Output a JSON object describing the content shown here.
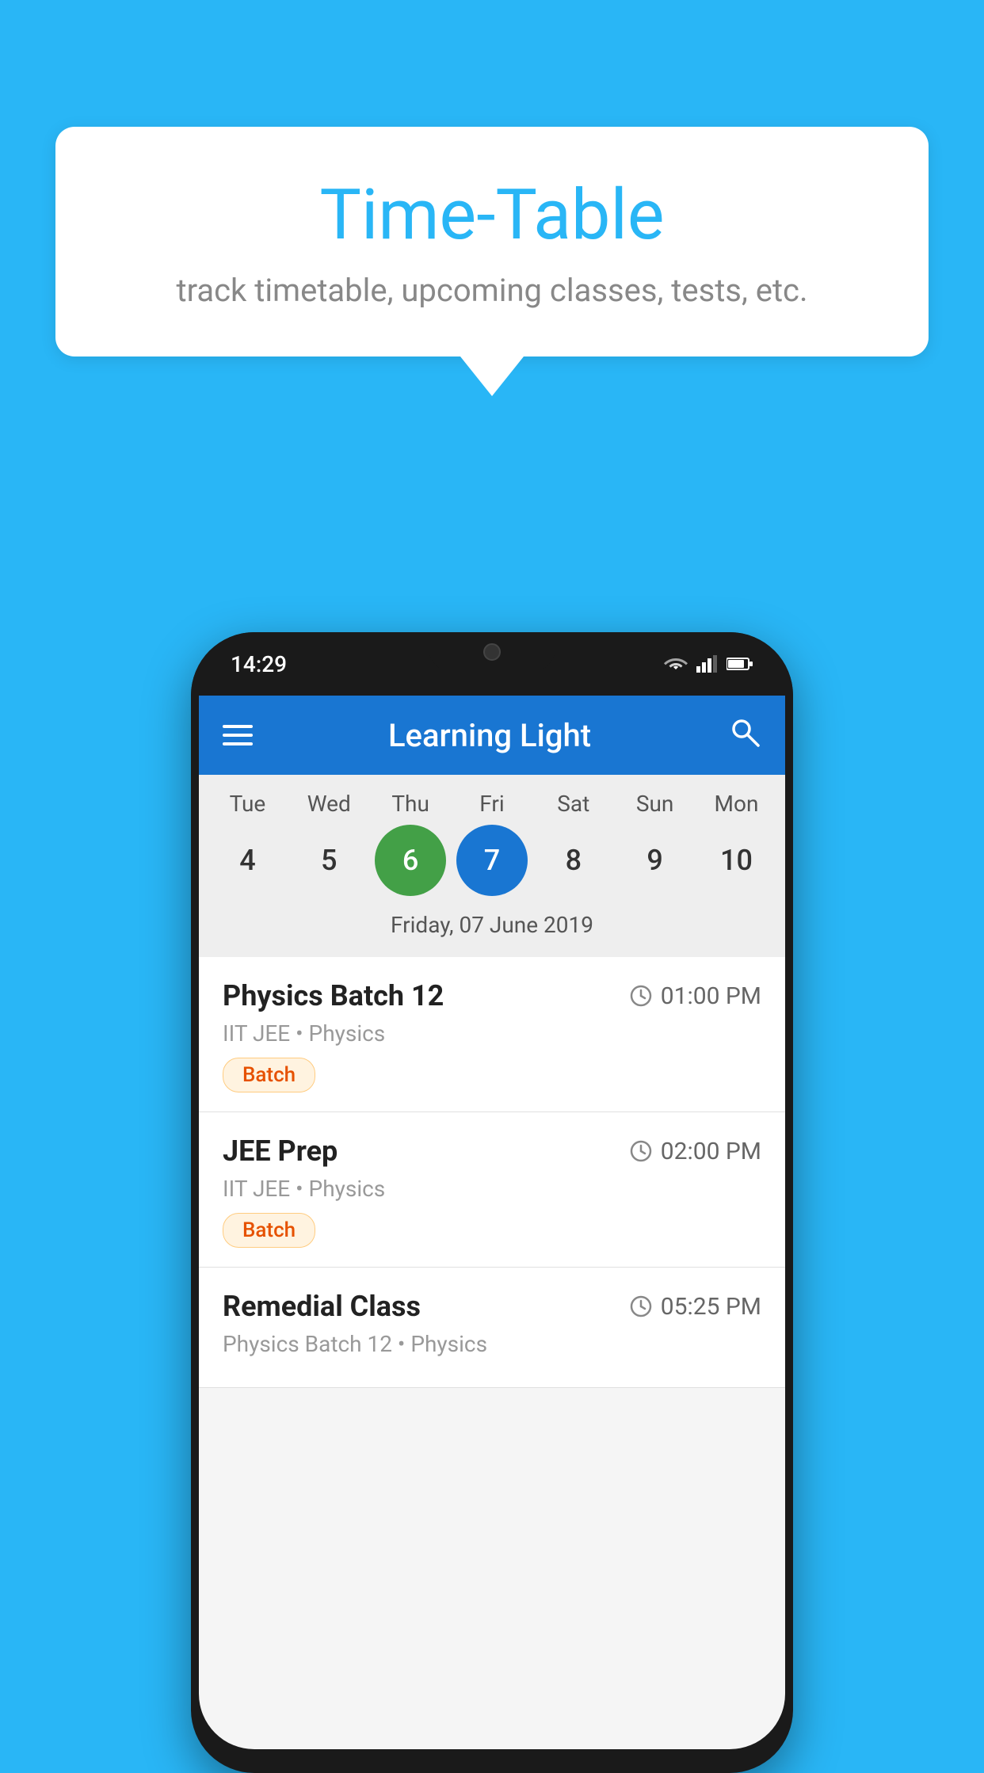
{
  "background_color": "#29b6f6",
  "speech_bubble": {
    "title": "Time-Table",
    "subtitle": "track timetable, upcoming classes, tests, etc."
  },
  "phone": {
    "status_bar": {
      "time": "14:29"
    },
    "app_bar": {
      "title": "Learning Light",
      "menu_icon": "menu-icon",
      "search_icon": "search-icon"
    },
    "calendar": {
      "days": [
        {
          "label": "Tue",
          "number": "4"
        },
        {
          "label": "Wed",
          "number": "5"
        },
        {
          "label": "Thu",
          "number": "6",
          "state": "today"
        },
        {
          "label": "Fri",
          "number": "7",
          "state": "selected"
        },
        {
          "label": "Sat",
          "number": "8"
        },
        {
          "label": "Sun",
          "number": "9"
        },
        {
          "label": "Mon",
          "number": "10"
        }
      ],
      "selected_date_label": "Friday, 07 June 2019"
    },
    "schedule": [
      {
        "title": "Physics Batch 12",
        "time": "01:00 PM",
        "subtitle": "IIT JEE • Physics",
        "tag": "Batch"
      },
      {
        "title": "JEE Prep",
        "time": "02:00 PM",
        "subtitle": "IIT JEE • Physics",
        "tag": "Batch"
      },
      {
        "title": "Remedial Class",
        "time": "05:25 PM",
        "subtitle": "Physics Batch 12 • Physics",
        "tag": null
      }
    ]
  }
}
